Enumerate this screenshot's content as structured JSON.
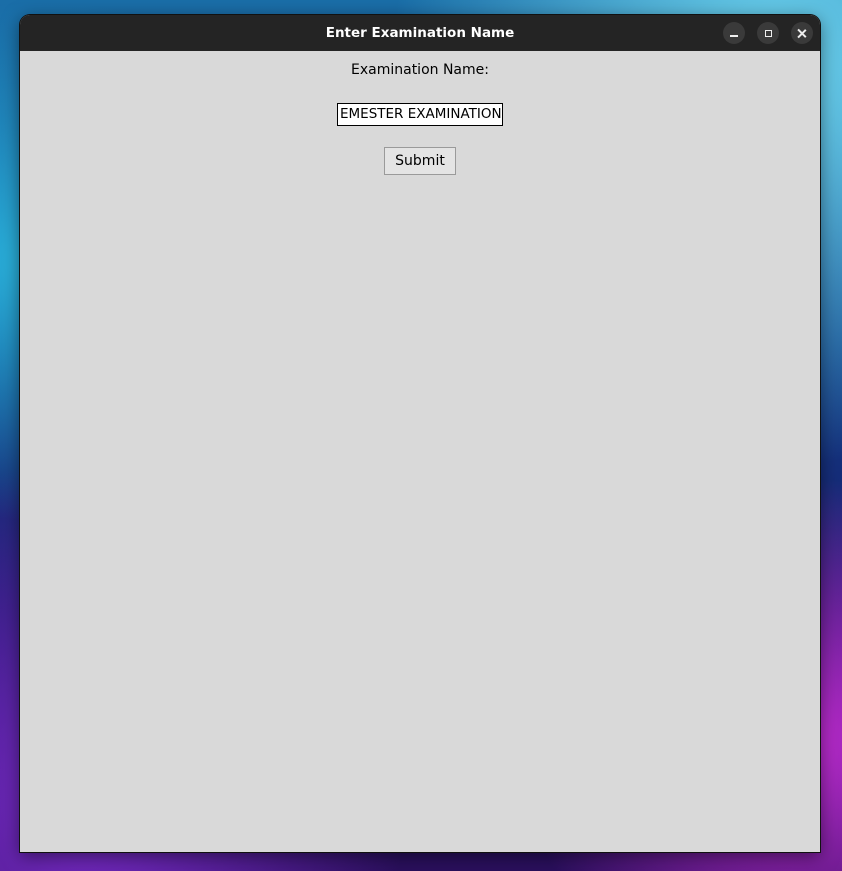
{
  "window": {
    "title": "Enter Examination Name",
    "controls": {
      "minimize": "minimize-icon",
      "maximize": "maximize-icon",
      "close": "close-icon"
    }
  },
  "form": {
    "label": "Examination Name:",
    "input_value": "EMESTER EXAMINATION",
    "submit_label": "Submit"
  },
  "colors": {
    "titlebar": "#242424",
    "window_bg": "#d9d9d9"
  }
}
